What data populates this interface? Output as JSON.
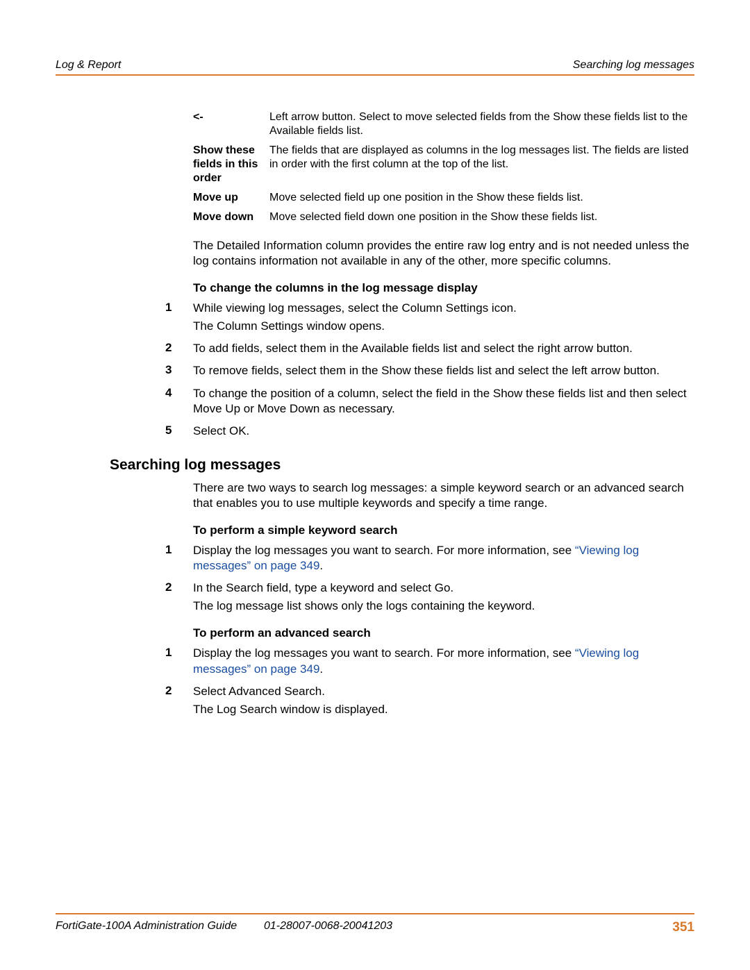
{
  "header": {
    "left": "Log & Report",
    "right": "Searching log messages"
  },
  "defs": [
    {
      "term": "<-",
      "desc": "Left arrow button. Select to move selected fields from the Show these fields list to the Available fields list."
    },
    {
      "term": "Show these fields in this order",
      "desc": "The fields that are displayed as columns in the log messages list. The fields are listed in order with the first column at the top of the list."
    },
    {
      "term": "Move up",
      "desc": "Move selected field up one position in the Show these fields list."
    },
    {
      "term": "Move down",
      "desc": "Move selected field down one position in the Show these fields list."
    }
  ],
  "detail_para": "The Detailed Information column provides the entire raw log entry and is not needed unless the log contains information not available in any of the other, more specific columns.",
  "change_cols_head": "To change the columns in the log message display",
  "change_steps": [
    {
      "n": "1",
      "a": "While viewing log messages, select the Column Settings icon.",
      "b": "The Column Settings window opens."
    },
    {
      "n": "2",
      "a": "To add fields, select them in the Available fields list and select the right arrow button."
    },
    {
      "n": "3",
      "a": "To remove fields, select them in the Show these fields list and select the left arrow button."
    },
    {
      "n": "4",
      "a": "To change the position of a column, select the field in the Show these fields list and then select Move Up or Move Down as necessary."
    },
    {
      "n": "5",
      "a": "Select OK."
    }
  ],
  "search_section_title": "Searching log messages",
  "search_para": "There are two ways to search log messages: a simple keyword search or an advanced search that enables you to use multiple keywords and specify a time range.",
  "simple_head": "To perform a simple keyword search",
  "simple_steps": [
    {
      "n": "1",
      "pre": "Display the log messages you want to search. For more information, see ",
      "link": "“Viewing log messages” on page 349",
      "post": "."
    },
    {
      "n": "2",
      "a": "In the Search field, type a keyword and select Go.",
      "b": "The log message list shows only the logs containing the keyword."
    }
  ],
  "adv_head": "To perform an advanced search",
  "adv_steps": [
    {
      "n": "1",
      "pre": "Display the log messages you want to search. For more information, see ",
      "link": "“Viewing log messages” on page 349",
      "post": "."
    },
    {
      "n": "2",
      "a": "Select Advanced Search.",
      "b": "The Log Search window is displayed."
    }
  ],
  "footer": {
    "left": "FortiGate-100A Administration Guide",
    "mid": "01-28007-0068-20041203",
    "page": "351"
  }
}
